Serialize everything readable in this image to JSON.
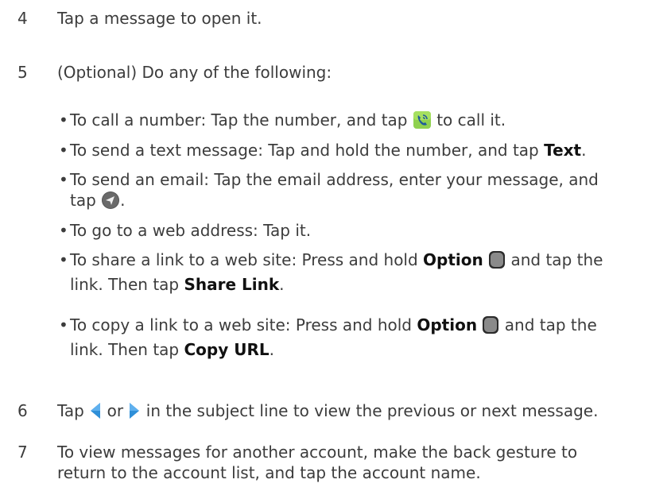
{
  "steps": [
    {
      "num": "4",
      "text": "Tap a message to open it."
    },
    {
      "num": "5",
      "text": "(Optional) Do any of the following:"
    },
    {
      "num": "6",
      "pre": "Tap",
      "mid": "or",
      "post": "in the subject line to view the previous or next message."
    },
    {
      "num": "7",
      "line1": "To view messages for another account, make the back gesture to",
      "line2": "return to the account list, and tap the account name."
    }
  ],
  "bullets": {
    "dot": "•",
    "call": {
      "pre": "To call a number: Tap the number, and tap",
      "post": "to call it."
    },
    "text": {
      "pre": "To send a text message: Tap and hold the number, and tap",
      "bold": "Text",
      "post": "."
    },
    "email": {
      "line1": "To send an email: Tap the email address, enter your message, and",
      "pre2": "tap",
      "post2": "."
    },
    "web": {
      "text": "To go to a web address: Tap it."
    },
    "share": {
      "pre": "To share a link to a web site: Press and hold",
      "bold": "Option",
      "post": "and tap the",
      "pre2": "link. Then tap",
      "bold2": "Share Link",
      "post2": "."
    },
    "copy": {
      "pre": "To copy a link to a web site: Press and hold",
      "bold": "Option",
      "post": "and tap the",
      "pre2": "link. Then tap",
      "bold2": "Copy URL",
      "post2": "."
    }
  },
  "icons": {
    "phone": "phone-call-icon",
    "send": "send-icon",
    "option": "option-key-icon",
    "prev": "previous-arrow-icon",
    "next": "next-arrow-icon"
  },
  "colors": {
    "text": "#3c3c3c",
    "bold": "#111111",
    "phone_green": "#7ac943",
    "arrow_blue": "#2f8fd8"
  }
}
